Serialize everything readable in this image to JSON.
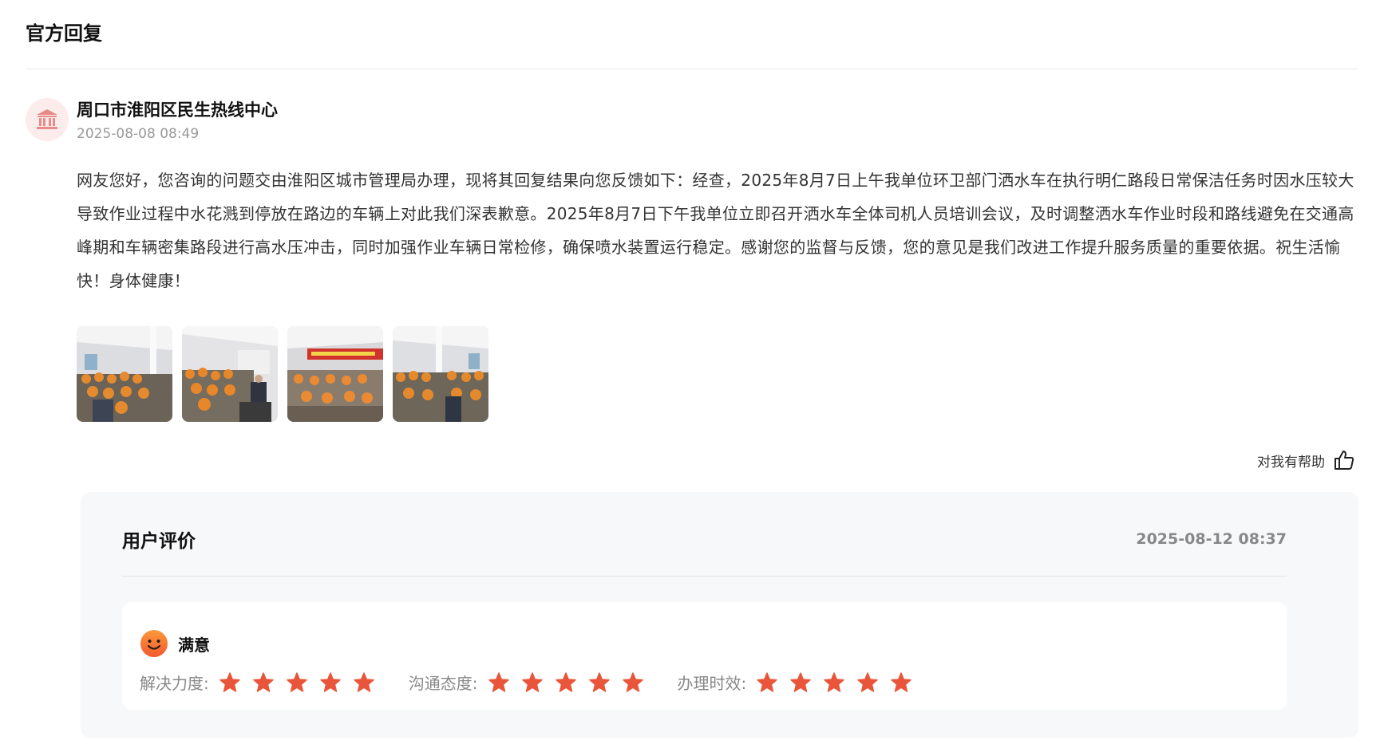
{
  "section": {
    "title": "官方回复"
  },
  "reply": {
    "org_name": "周口市淮阳区民生热线中心",
    "time": "2025-08-08 08:49",
    "avatar_icon": "government-building-icon",
    "body": "网友您好，您咨询的问题交由淮阳区城市管理局办理，现将其回复结果向您反馈如下：经查，2025年8月7日上午我单位环卫部门洒水车在执行明仁路段日常保洁任务时因水压较大导致作业过程中水花溅到停放在路边的车辆上对此我们深表歉意。2025年8月7日下午我单位立即召开洒水车全体司机人员培训会议，及时调整洒水车作业时段和路线避免在交通高峰期和车辆密集路段进行高水压冲击，同时加强作业车辆日常检修，确保喷水装置运行稳定。感谢您的监督与反馈，您的意见是我们改进工作提升服务质量的重要依据。祝生活愉快！身体健康！",
    "photos": [
      {
        "name": "meeting-photo-1"
      },
      {
        "name": "meeting-photo-2"
      },
      {
        "name": "meeting-photo-3"
      },
      {
        "name": "meeting-photo-4"
      }
    ],
    "helpful_label": "对我有帮助",
    "helpful_icon": "thumbs-up-icon"
  },
  "review": {
    "title": "用户评价",
    "date": "2025-08-12 08:37",
    "mood_label": "满意",
    "mood_icon": "smiley-face-icon",
    "ratings": [
      {
        "label": "解决力度:",
        "stars": 5,
        "max": 5
      },
      {
        "label": "沟通态度:",
        "stars": 5,
        "max": 5
      },
      {
        "label": "办理时效:",
        "stars": 5,
        "max": 5
      }
    ],
    "star_color": "#e8553a"
  }
}
